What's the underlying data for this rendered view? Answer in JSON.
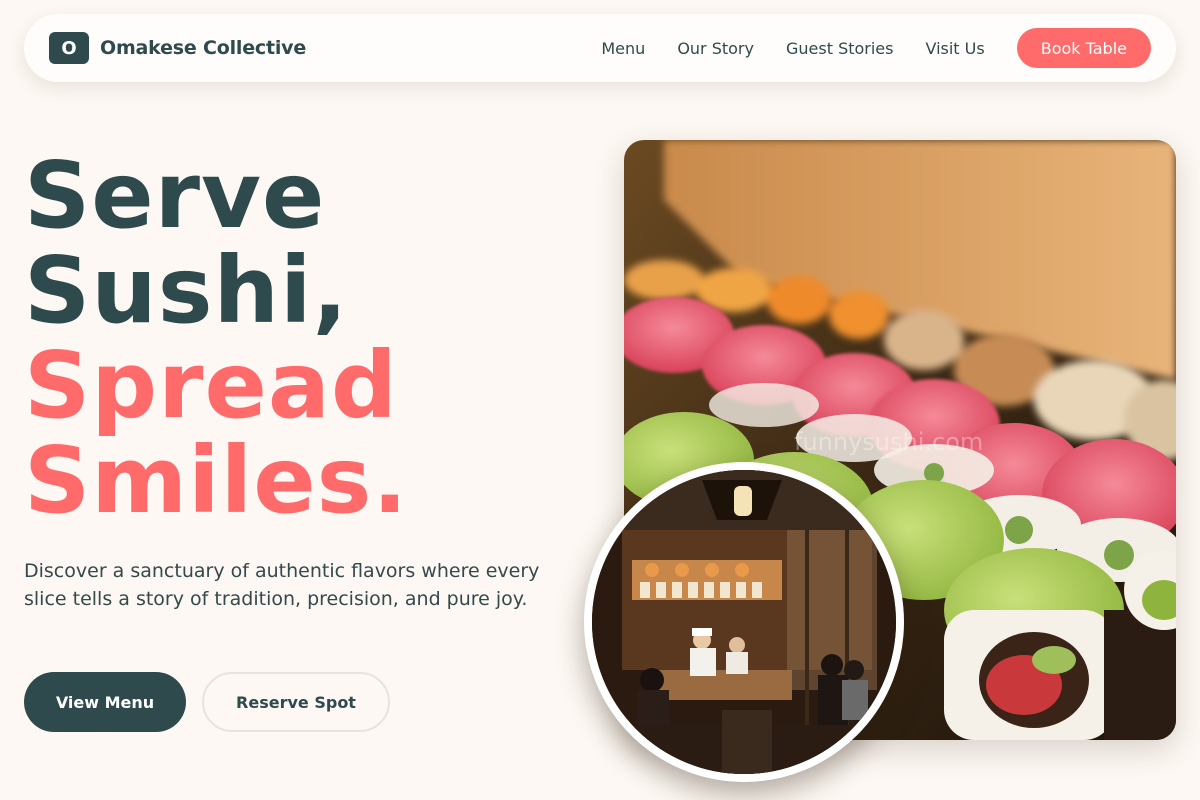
{
  "nav": {
    "logo_letter": "O",
    "brand": "Omakese Collective",
    "links": [
      "Menu",
      "Our Story",
      "Guest Stories",
      "Visit Us"
    ],
    "cta": "Book Table"
  },
  "hero": {
    "headline_dark": [
      "Serve",
      "Sushi,"
    ],
    "headline_coral": [
      "Spread",
      "Smiles."
    ],
    "description": "Discover a sanctuary of authentic flavors where every slice tells a story of tradition, precision, and pure joy.",
    "primary_button": "View Menu",
    "secondary_button": "Reserve Spot"
  },
  "images": {
    "main": "sushi-rolls-photo",
    "inset": "restaurant-interior-photo",
    "watermark": "funnysushi.com"
  },
  "colors": {
    "accent": "#ff6b6b",
    "primary": "#2f4a4c",
    "background": "#fdf8f3"
  }
}
